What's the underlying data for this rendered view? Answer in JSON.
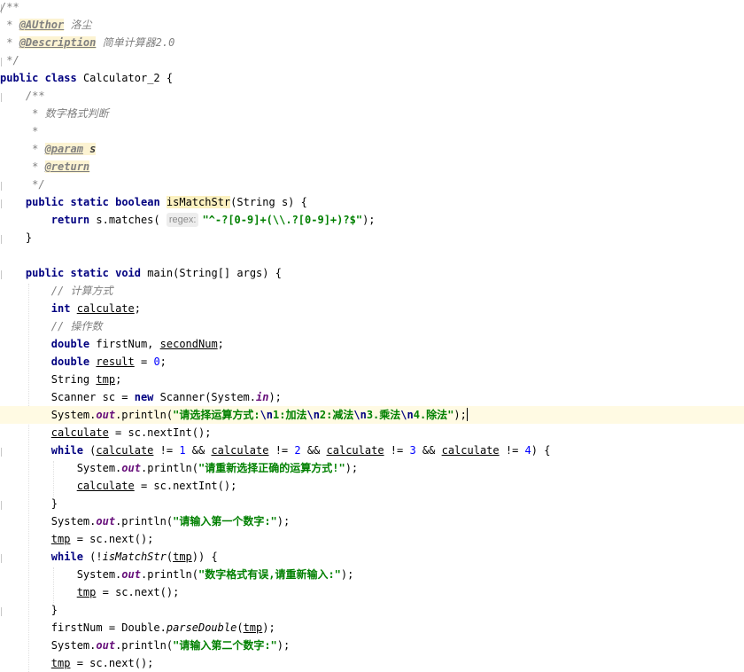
{
  "editor": {
    "file_class": "Calculator_2",
    "doc_comment": {
      "open": "/**",
      "author_tag": "@AUthor",
      "author_value": "洛尘",
      "description_tag": "@Description",
      "description_value": "简单计算器2.0",
      "close": "*/"
    },
    "method_doc": {
      "open": "/**",
      "summary": "数字格式判断",
      "param_tag": "@param",
      "param_name": "s",
      "return_tag": "@return",
      "close": "*/"
    },
    "method_name": "isMatchStr",
    "param_hint": "regex:",
    "regex_literal": "\"^-?[0-9]+(\\\\.?[0-9]+)?$\"",
    "comment_calc": "// 计算方式",
    "comment_operands": "// 操作数",
    "str_select_op": "请选择运算方式:",
    "str_op1": "1:加法",
    "str_op2": "2:减法",
    "str_op3": "3.乘法",
    "str_op4": "4.除法",
    "str_reselect": "\"请重新选择正确的运算方式!\"",
    "str_first": "\"请输入第一个数字:\"",
    "str_bad_format": "\"数字格式有误,请重新输入:\"",
    "str_second": "\"请输入第二个数字:\"",
    "numbers": {
      "zero": "0",
      "one": "1",
      "two": "2",
      "three": "3",
      "four": "4"
    }
  }
}
